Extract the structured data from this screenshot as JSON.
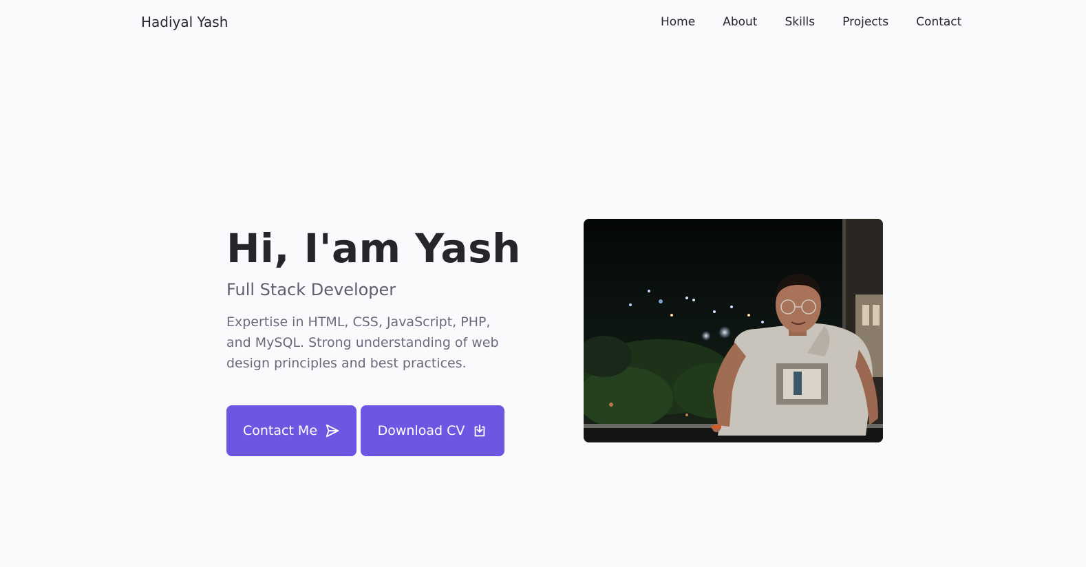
{
  "header": {
    "logo": "Hadiyal Yash",
    "nav": [
      {
        "label": "Home"
      },
      {
        "label": "About"
      },
      {
        "label": "Skills"
      },
      {
        "label": "Projects"
      },
      {
        "label": "Contact"
      }
    ]
  },
  "hero": {
    "title": "Hi, I'am Yash",
    "subtitle": "Full Stack Developer",
    "description": "Expertise in HTML, CSS, JavaScript, PHP, and MySQL. Strong understanding of web design principles and best practices.",
    "buttons": {
      "contact": {
        "label": "Contact Me",
        "icon": "send-icon"
      },
      "download": {
        "label": "Download CV",
        "icon": "download-icon"
      }
    },
    "photo": {
      "icon": "profile-photo"
    }
  },
  "colors": {
    "background": "#fafafc",
    "accent": "#6c57e2",
    "heading": "#25252c",
    "subtitle": "#5f5e70",
    "body_text": "#6a697c"
  }
}
